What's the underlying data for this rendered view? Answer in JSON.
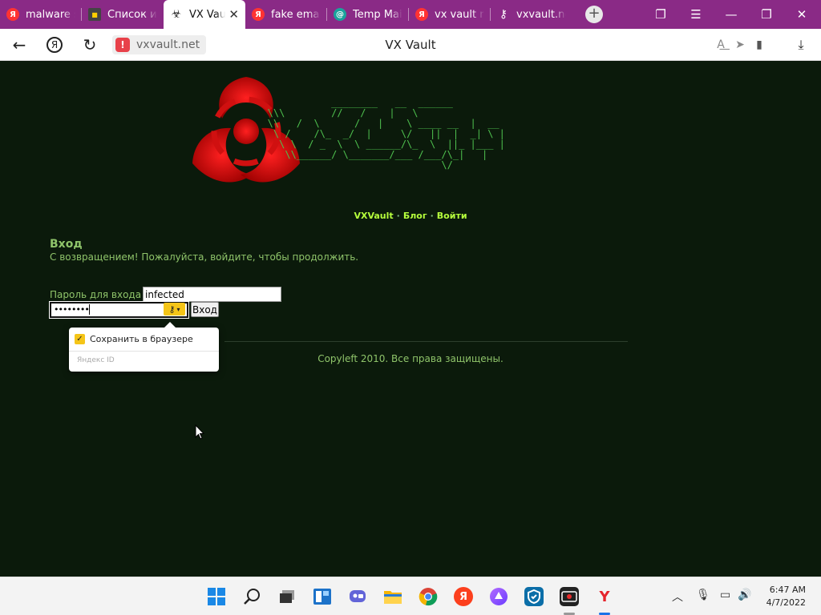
{
  "tabs": [
    {
      "label": "malware s",
      "icon": "yandex-icon",
      "active": false
    },
    {
      "label": "Список и",
      "icon": "archive-site-icon",
      "active": false
    },
    {
      "label": "VX Vault",
      "icon": "biohazard-icon",
      "active": true
    },
    {
      "label": "fake emai",
      "icon": "yandex-icon",
      "active": false
    },
    {
      "label": "Temp Mai",
      "icon": "temp-mail-icon",
      "active": false
    },
    {
      "label": "vx vault ro",
      "icon": "yandex-icon",
      "active": false
    },
    {
      "label": "vxvault.ne",
      "icon": "key-icon",
      "active": false
    }
  ],
  "address": {
    "domain": "vxvault.net",
    "page_title": "VX Vault"
  },
  "site": {
    "ascii_logo": "              ________   __  ______     \n   \\\\\\        //   /    |   \\          \n   \\\\   /  \\      /   |    \\ ____ __  |  __ \n    \\ /    /\\_  _/  |     \\/   ||  |  _| \\ |\n     \\ \\  / _  \\  \\ ______/\\_  \\  ||_ |___ |\n      \\\\______/ \\_______/___ /___/\\_|   |\n                                 \\/     ",
    "nav": {
      "vxvault": "VXVault",
      "blog": "Блог",
      "login": "Войти"
    },
    "login": {
      "heading": "Вход",
      "subtitle": "С возвращением! Пожалуйста, войдите, чтобы продолжить.",
      "password_label": "Пароль для входа",
      "password_value": "infected",
      "masked_password": "••••••••",
      "submit": "Вход"
    },
    "footer": "Copyleft 2010. Все права защищены."
  },
  "password_popup": {
    "save_label": "Сохранить в браузере",
    "brand": "Яндекс ID"
  },
  "clock": {
    "time": "6:47 AM",
    "date": "4/7/2022"
  }
}
